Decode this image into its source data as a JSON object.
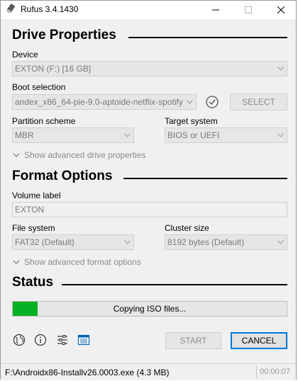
{
  "window": {
    "title": "Rufus 3.4.1430"
  },
  "drive_properties": {
    "heading": "Drive Properties",
    "device_label": "Device",
    "device_value": "EXTON (F:) [16 GB]",
    "boot_selection_label": "Boot selection",
    "boot_selection_value": "andex_x86_64-pie-9.0-aptoide-netflix-spotify",
    "select_button": "SELECT",
    "partition_scheme_label": "Partition scheme",
    "partition_scheme_value": "MBR",
    "target_system_label": "Target system",
    "target_system_value": "BIOS or UEFI",
    "advanced_toggle": "Show advanced drive properties"
  },
  "format_options": {
    "heading": "Format Options",
    "volume_label_label": "Volume label",
    "volume_label_value": "EXTON",
    "file_system_label": "File system",
    "file_system_value": "FAT32 (Default)",
    "cluster_size_label": "Cluster size",
    "cluster_size_value": "8192 bytes (Default)",
    "advanced_toggle": "Show advanced format options"
  },
  "status": {
    "heading": "Status",
    "progress_text": "Copying ISO files...",
    "progress_fraction": 0.09,
    "progress_color": "#06b025"
  },
  "footer": {
    "icons": [
      "globe-icon",
      "info-icon",
      "settings-sliders-icon",
      "log-icon"
    ],
    "start_button": "START",
    "cancel_button": "CANCEL"
  },
  "statusbar": {
    "left_text": "F:\\Androidx86-Installv26.0003.exe (4.3 MB)",
    "right_text": "00:00:07"
  }
}
